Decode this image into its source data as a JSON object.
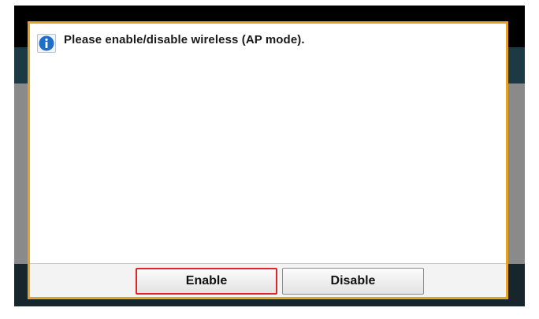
{
  "dialog": {
    "message": "Please enable/disable wireless (AP mode).",
    "icon": "info-icon",
    "border_color": "#e4a226"
  },
  "buttons": {
    "enable_label": "Enable",
    "disable_label": "Disable",
    "selected": "Enable",
    "selected_border_color": "#e02525"
  }
}
